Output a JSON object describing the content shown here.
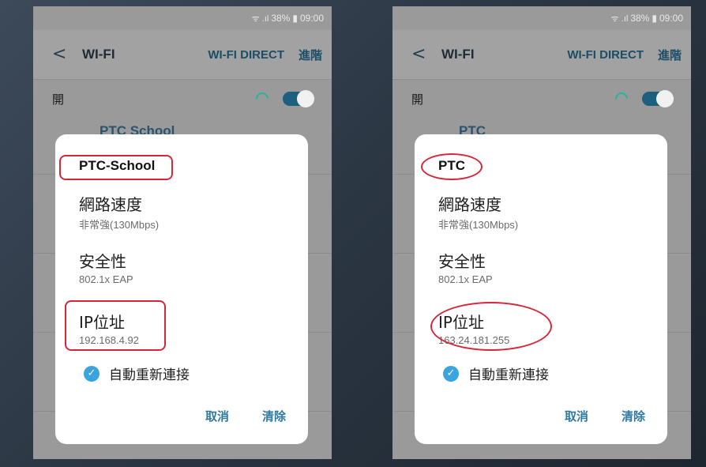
{
  "phones": [
    {
      "status": {
        "battery": "38%",
        "time": "09:00"
      },
      "app_bar": {
        "back": "<",
        "title": "WI-FI",
        "wifi_direct": "WI-FI DIRECT",
        "advanced": "進階"
      },
      "switch_row": {
        "label": "開"
      },
      "background_network": "PTC School",
      "dialog": {
        "network_name": "PTC-School",
        "speed_label": "網路速度",
        "speed_value": "非常強(130Mbps)",
        "security_label": "安全性",
        "security_value": "802.1x EAP",
        "ip_label": "IP位址",
        "ip_value": "192.168.4.92",
        "auto_reconnect": "自動重新連接",
        "cancel": "取消",
        "forget": "清除"
      },
      "highlight_style": "rectangle"
    },
    {
      "status": {
        "battery": "38%",
        "time": "09:00"
      },
      "app_bar": {
        "back": "<",
        "title": "WI-FI",
        "wifi_direct": "WI-FI DIRECT",
        "advanced": "進階"
      },
      "switch_row": {
        "label": "開"
      },
      "background_network": "PTC",
      "dialog": {
        "network_name": "PTC",
        "speed_label": "網路速度",
        "speed_value": "非常強(130Mbps)",
        "security_label": "安全性",
        "security_value": "802.1x EAP",
        "ip_label": "IP位址",
        "ip_value": "163.24.181.255",
        "auto_reconnect": "自動重新連接",
        "cancel": "取消",
        "forget": "清除"
      },
      "highlight_style": "oval"
    }
  ],
  "colors": {
    "accent": "#3aa4df",
    "button_text": "#2f7aa0",
    "annotation": "#d6263a",
    "toggle": "#1c5f7e"
  }
}
